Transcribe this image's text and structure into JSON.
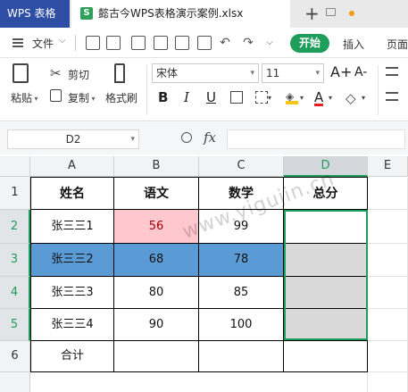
{
  "tabs": {
    "app_name": "WPS 表格",
    "doc_title": "懿古今WPS表格演示案例.xlsx",
    "doc_icon_letter": "S",
    "add": "+"
  },
  "ribbon": {
    "file_menu": "文件",
    "tabs": [
      "开始",
      "插入",
      "页面"
    ],
    "paste": "粘贴",
    "cut": "剪切",
    "copy": "复制",
    "format_painter": "格式刷",
    "font_name": "宋体",
    "font_size": "11",
    "bold": "B",
    "italic": "I",
    "underline": "U",
    "grow_font": "A+",
    "shrink_font": "A-",
    "font_color_letter": "A",
    "font_color": "#e02020",
    "fill_color": "#f5c518"
  },
  "formula_bar": {
    "name_box": "D2",
    "fx_label": "fx",
    "formula": ""
  },
  "sheet": {
    "columns": [
      "A",
      "B",
      "C",
      "D",
      "E"
    ],
    "active_column": "D",
    "rows": [
      "1",
      "2",
      "3",
      "4",
      "5",
      "6"
    ],
    "header_row": [
      "姓名",
      "语文",
      "数学",
      "总分"
    ],
    "data_rows": [
      [
        "张三三1",
        "56",
        "99",
        ""
      ],
      [
        "张三三2",
        "68",
        "78",
        ""
      ],
      [
        "张三三3",
        "80",
        "85",
        ""
      ],
      [
        "张三三4",
        "90",
        "100",
        ""
      ]
    ],
    "total_row": [
      "合计",
      "",
      "",
      ""
    ],
    "highlight_colors": {
      "pink_fill": "#ffc7ce",
      "blue_fill": "#5b9bd5",
      "gray_fill": "#d9d9d9",
      "selection": "#1f9d5a"
    }
  },
  "watermark": "www.yigujin.cn"
}
